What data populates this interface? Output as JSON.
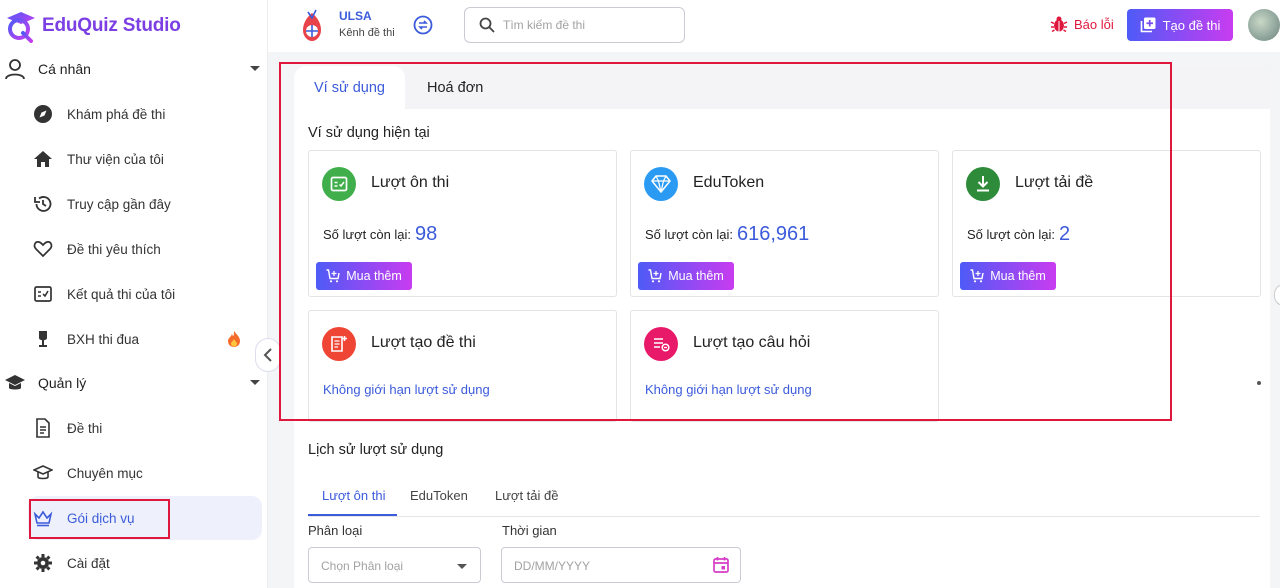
{
  "app": {
    "name": "EduQuiz Studio"
  },
  "sidebar": {
    "personal": {
      "label": "Cá nhân"
    },
    "items": [
      {
        "label": "Khám phá đề thi",
        "icon": "compass-icon"
      },
      {
        "label": "Thư viện của tôi",
        "icon": "home-icon"
      },
      {
        "label": "Truy cập gần đây",
        "icon": "history-icon"
      },
      {
        "label": "Đề thi yêu thích",
        "icon": "heart-icon"
      },
      {
        "label": "Kết quả thi của tôi",
        "icon": "result-icon"
      },
      {
        "label": "BXH thi đua",
        "icon": "trophy-icon"
      }
    ],
    "manage": {
      "label": "Quản lý"
    },
    "manage_items": [
      {
        "label": "Đề thi",
        "icon": "document-icon"
      },
      {
        "label": "Chuyên mục",
        "icon": "graduation-cap-icon"
      },
      {
        "label": "Gói dịch vụ",
        "icon": "crown-icon",
        "active": true
      },
      {
        "label": "Cài đặt",
        "icon": "gear-icon"
      }
    ]
  },
  "topbar": {
    "org_name": "ULSA",
    "org_sub": "Kênh đề thi",
    "search_placeholder": "Tìm kiếm đề thi",
    "report_label": "Báo lỗi",
    "create_label": "Tạo đề thi"
  },
  "tabs": {
    "wallet": "Ví sử dụng",
    "invoice": "Hoá đơn"
  },
  "wallet": {
    "title": "Ví sử dụng hiện tại",
    "remain_label": "Số lượt còn lại:",
    "buy_label": "Mua thêm",
    "unlimited_label": "Không giới hạn lượt sử dụng",
    "cards": [
      {
        "title": "Lượt ôn thi",
        "value": "98"
      },
      {
        "title": "EduToken",
        "value": "616,961"
      },
      {
        "title": "Lượt tải đề",
        "value": "2"
      },
      {
        "title": "Lượt tạo đề thi"
      },
      {
        "title": "Lượt tạo câu hỏi"
      }
    ]
  },
  "history": {
    "title": "Lịch sử lượt sử dụng",
    "tabs": [
      "Lượt ôn thi",
      "EduToken",
      "Lượt tải đề"
    ],
    "category_label": "Phân loại",
    "category_placeholder": "Chọn Phân loại",
    "time_label": "Thời gian",
    "time_placeholder": "DD/MM/YYYY"
  },
  "colors": {
    "accent": "#3b5bdb",
    "highlight": "#e0173d",
    "brand": "#7b3fe4"
  }
}
